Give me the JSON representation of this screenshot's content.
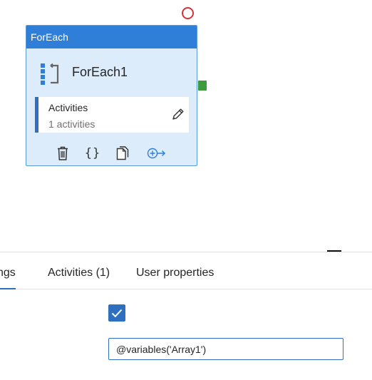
{
  "activity_node": {
    "type_label": "ForEach",
    "name": "ForEach1",
    "activities_title": "Activities",
    "activities_count": "1 activities"
  },
  "tabs": {
    "settings": "tings",
    "activities": "Activities (1)",
    "user_properties": "User properties"
  },
  "settings": {
    "sequential_checked": true,
    "items_value": "@variables('Array1')"
  },
  "colors": {
    "accent": "#2f6fc0",
    "node_header": "#2f7fd8",
    "node_body": "#dcecfb",
    "error": "#d13438",
    "success": "#3d9a3d"
  }
}
